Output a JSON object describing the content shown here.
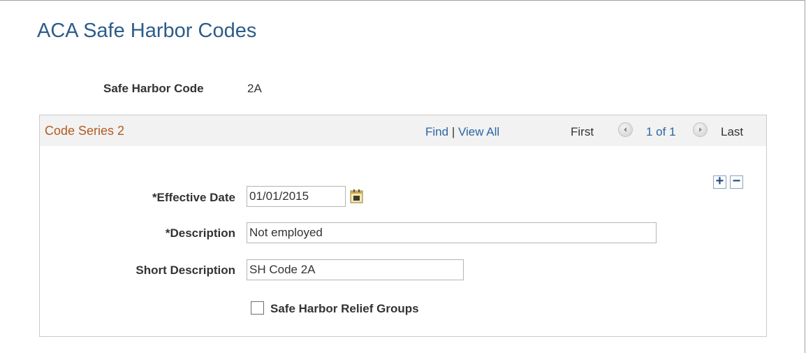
{
  "page": {
    "title": "ACA Safe Harbor Codes",
    "safe_harbor_code_label": "Safe Harbor Code",
    "safe_harbor_code_value": "2A"
  },
  "panel": {
    "title": "Code Series 2",
    "find_label": "Find",
    "separator": "|",
    "view_all_label": "View All",
    "first_label": "First",
    "count_label": "1 of 1",
    "last_label": "Last",
    "add_row_symbol": "+",
    "delete_row_symbol": "−"
  },
  "form": {
    "effective_date_label": "*Effective Date",
    "effective_date_value": "01/01/2015",
    "description_label": "*Description",
    "description_value": "Not employed",
    "short_description_label": "Short Description",
    "short_description_value": "SH Code 2A",
    "relief_groups_label": "Safe Harbor Relief Groups",
    "relief_groups_checked": false
  },
  "icons": {
    "calendar": "calendar-icon",
    "prev": "arrow-left-icon",
    "next": "arrow-right-icon"
  },
  "colors": {
    "title": "#2d5c8a",
    "panel_title": "#b35a1f",
    "link": "#2a66a3",
    "panel_header_bg": "#f2f2f2"
  }
}
